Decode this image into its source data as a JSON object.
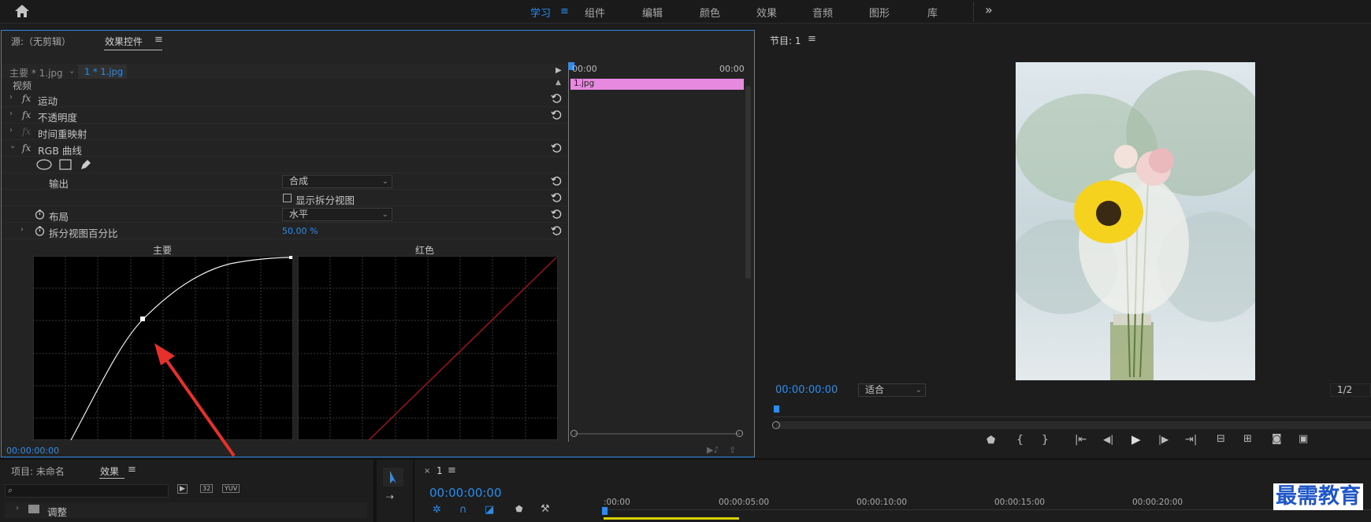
{
  "workspaces": [
    "学习",
    "组件",
    "编辑",
    "颜色",
    "效果",
    "音频",
    "图形",
    "库"
  ],
  "effect_controls": {
    "tab_source": "源:（无剪辑）",
    "tab_effects": "效果控件",
    "clip_master": "主要 * 1.jpg",
    "clip_active": "1 * 1.jpg",
    "section_video": "视频",
    "effects": [
      "运动",
      "不透明度",
      "时间重映射",
      "RGB 曲线"
    ],
    "output_label": "输出",
    "output_value": "合成",
    "split_view_label": "显示拆分视图",
    "layout_label": "布局",
    "layout_value": "水平",
    "split_pct_label": "拆分视图百分比",
    "split_pct_value": "50.00 %",
    "curve_master_label": "主要",
    "curve_red_label": "红色",
    "timecode": "00:00:00:00",
    "timeline_start": "00:00",
    "timeline_end": "00:00",
    "clip_name": "1.jpg"
  },
  "program": {
    "title": "节目: 1",
    "timecode": "00:00:00:00",
    "fit": "适合",
    "resolution": "1/2"
  },
  "project": {
    "tab_project": "项目: 未命名",
    "tab_effects": "效果",
    "folder": "调整"
  },
  "timeline": {
    "sequence": "1",
    "timecode": "00:00:00:00",
    "ruler": [
      ":00:00",
      "00:00:05:00",
      "00:00:10:00",
      "00:00:15:00",
      "00:00:20:00"
    ]
  },
  "watermark": "最需教育",
  "colors": {
    "accent": "#2d8ceb",
    "clip": "#e889e0",
    "curve_red": "#c0121c",
    "arrow": "#e8302a"
  }
}
